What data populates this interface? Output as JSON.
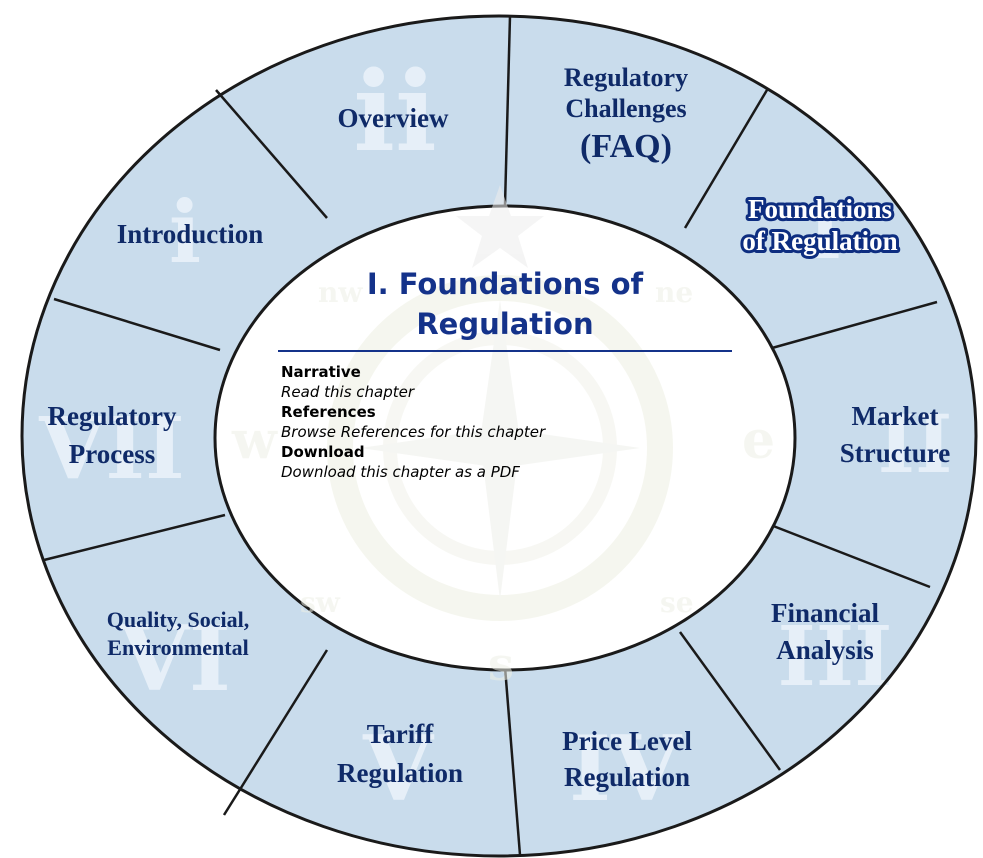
{
  "center": {
    "title_line1": "I. Foundations of",
    "title_line2": "Regulation",
    "items": [
      {
        "heading": "Narrative",
        "description": "Read this chapter"
      },
      {
        "heading": "References",
        "description": "Browse References for this chapter"
      },
      {
        "heading": "Download",
        "description": "Download this chapter as a PDF"
      }
    ]
  },
  "segments": {
    "overview": {
      "lines": [
        "Overview"
      ],
      "numeral": "ii"
    },
    "faq": {
      "lines": [
        "Regulatory",
        "Challenges",
        "(FAQ)"
      ]
    },
    "foundations": {
      "lines": [
        "Foundations",
        "of Regulation"
      ],
      "numeral": "I"
    },
    "market": {
      "lines": [
        "Market",
        "Structure"
      ],
      "numeral": "II"
    },
    "financial": {
      "lines": [
        "Financial",
        "Analysis"
      ],
      "numeral": "III"
    },
    "price": {
      "lines": [
        "Price Level",
        "Regulation"
      ],
      "numeral": "IV"
    },
    "tariff": {
      "lines": [
        "Tariff",
        "Regulation"
      ],
      "numeral": "V"
    },
    "quality": {
      "lines": [
        "Quality, Social,",
        "Environmental"
      ],
      "numeral": "VI"
    },
    "process": {
      "lines": [
        "Regulatory",
        "Process"
      ],
      "numeral": "VII"
    },
    "introduction": {
      "lines": [
        "Introduction"
      ],
      "numeral": "i"
    }
  },
  "compass": {
    "nw": "nw",
    "ne": "ne",
    "w": "w",
    "e": "e",
    "sw": "sw",
    "se": "se",
    "s": "s"
  },
  "colors": {
    "segment_fill": "#c9dcec",
    "title": "#14328a",
    "label": "#0f2a68",
    "active_outline": "#0d2d80"
  }
}
